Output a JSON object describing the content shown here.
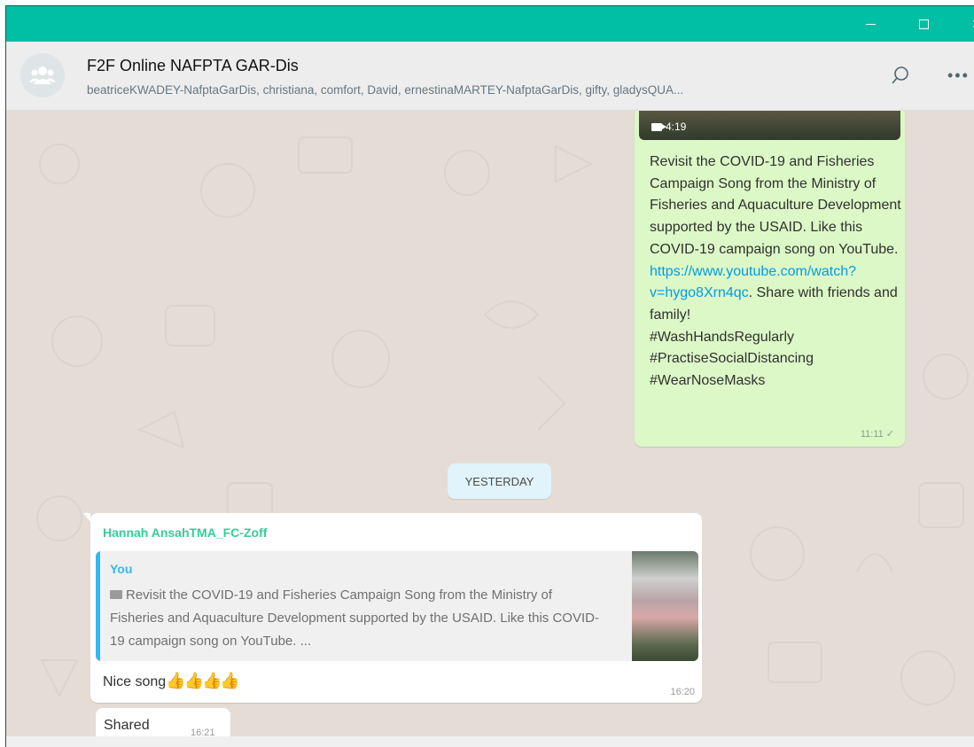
{
  "window": {
    "accent": "#00bfa5",
    "controls": {
      "minimize": "minimize-icon",
      "maximize": "maximize-icon",
      "close": "close-icon"
    }
  },
  "header": {
    "title": "F2F Online NAFPTA GAR-Dis",
    "members": "beatriceKWADEY-NafptaGarDis, christiana, comfort, David, ernestinaMARTEY-NafptaGarDis, gifty, gladysQUA...",
    "search_icon": "search-icon",
    "menu_icon": "more-options-icon"
  },
  "messages": {
    "outgoing": {
      "video_duration": "4:19",
      "text_before_link": "Revisit the COVID-19 and Fisheries Campaign Song from the Ministry of Fisheries and Aquaculture Development supported by the USAID. Like this COVID-19 campaign song on YouTube.",
      "link": "https://www.youtube.com/watch?v=hygo8Xrn4qc",
      "text_after_link": ". Share with friends and family!",
      "hashtags": [
        "#WashHandsRegularly",
        "#PractiseSocialDistancing",
        "#WearNoseMasks"
      ],
      "time": "11:11",
      "status": "✓"
    },
    "date_divider": "YESTERDAY",
    "incoming": {
      "sender": "Hannah AnsahTMA_FC-Zoff",
      "quote_author": "You",
      "quote_text": "Revisit the COVID-19 and Fisheries Campaign Song from the Ministry of Fisheries and Aquaculture Development supported by the USAID. Like this COVID-19 campaign song on YouTube. ...",
      "text": "Nice song",
      "emoji": "👍👍👍👍",
      "time": "16:20"
    },
    "incoming2": {
      "text": "Shared",
      "time": "16:21"
    }
  },
  "colors": {
    "outgoing_bubble": "#dcf8c6",
    "incoming_bubble": "#ffffff",
    "chat_background": "#e5ddd5",
    "sender_name": "#35cd96",
    "link": "#039be5"
  }
}
